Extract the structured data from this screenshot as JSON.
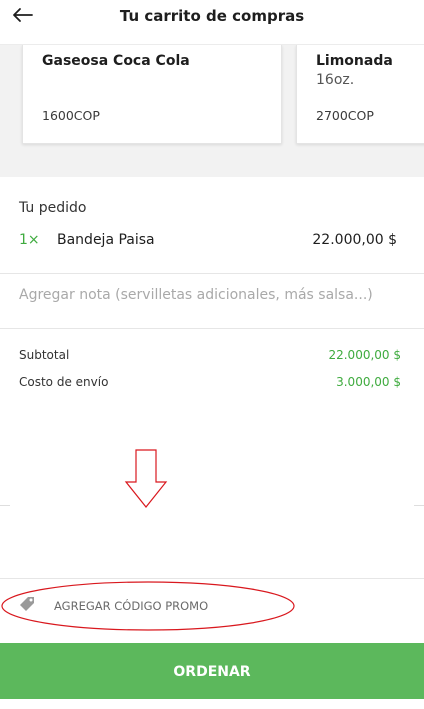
{
  "header": {
    "title": "Tu carrito de compras",
    "back_icon": "arrow-left-icon"
  },
  "recommendations": [
    {
      "name": "Gaseosa Coca Cola",
      "detail": "",
      "price": "1600COP"
    },
    {
      "name": "Limonada",
      "detail": "16oz.",
      "price": "2700COP"
    }
  ],
  "order": {
    "title": "Tu pedido",
    "items": [
      {
        "qty": "1×",
        "name": "Bandeja Paisa",
        "price": "22.000,00 $"
      }
    ],
    "note_placeholder": "Agregar nota (servilletas adicionales, más salsa...)"
  },
  "summary": {
    "subtotal_label": "Subtotal",
    "subtotal_value": "22.000,00 $",
    "delivery_label": "Costo de envío",
    "delivery_value": "3.000,00 $"
  },
  "promo": {
    "label": "AGREGAR CÓDIGO PROMO",
    "icon": "tag-icon"
  },
  "order_button": {
    "label": "ORDENAR"
  },
  "colors": {
    "accent_green": "#5cb85c",
    "price_green": "#3fab3f",
    "annotation_red": "#d9181e"
  }
}
